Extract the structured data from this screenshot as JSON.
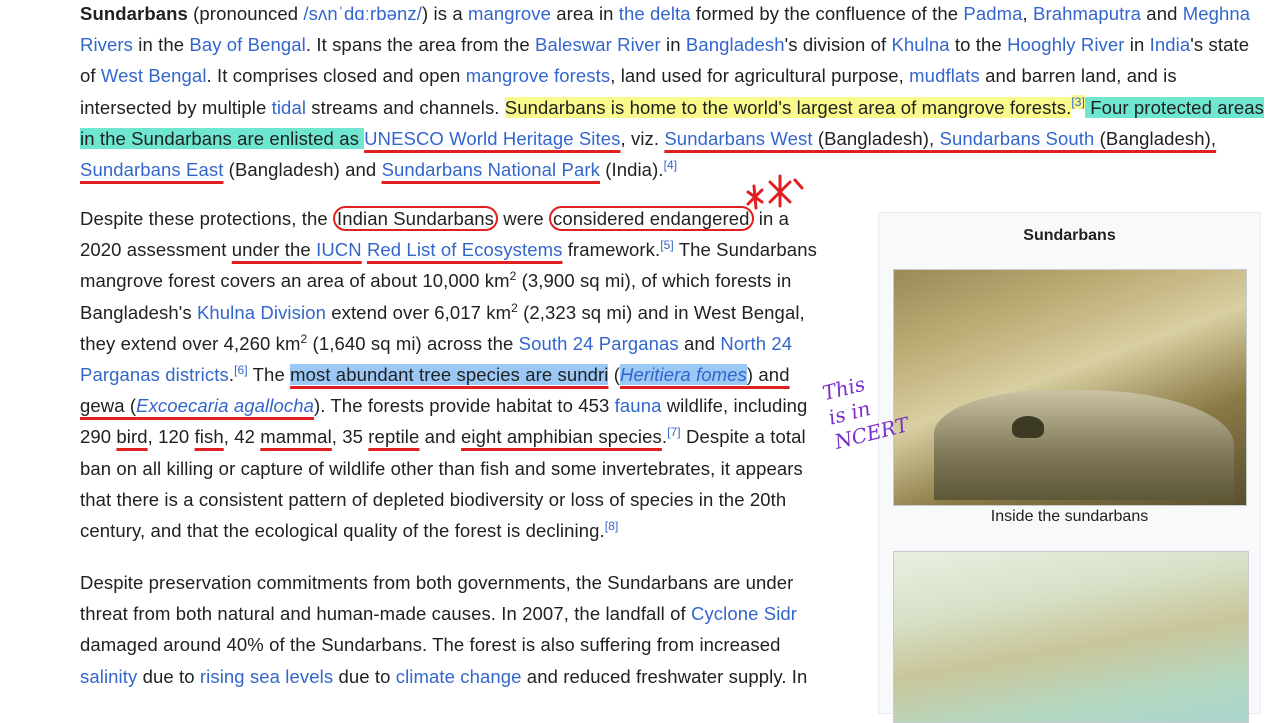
{
  "p1": {
    "s1": "Sundarbans",
    "s2": " (pronounced ",
    "ipa": "/sʌnˈdɑːrbənz/",
    "s3": ") is a ",
    "l_mangrove": "mangrove",
    "s4": " area in ",
    "l_delta": "the delta",
    "s5": " formed by the confluence of the ",
    "l_padma": "Padma",
    "s6": ", ",
    "l_brahma": "Brahmaputra",
    "s7": " and ",
    "l_meghna": "Meghna Rivers",
    "s8": " in the ",
    "l_bay": "Bay of Bengal",
    "s9": ". It spans the area from the ",
    "l_baleswar": "Baleswar River",
    "s10": " in ",
    "l_bangladesh": "Bangladesh",
    "s11": "'s division of ",
    "l_khulna": "Khulna",
    "s12": " to the ",
    "l_hooghly": "Hooghly River",
    "s13": " in ",
    "l_india": "India",
    "s14": "'s state of ",
    "l_wb": "West Bengal",
    "s15": ". It comprises closed and open ",
    "l_mforests": "mangrove forests",
    "s16": ", land used for agricultural purpose, ",
    "l_mudflats": "mudflats",
    "s17": " and barren land, and is intersected by multiple ",
    "l_tidal": "tidal",
    "s18": " streams and channels. ",
    "hl1": "Sundarbans is home to the world's largest area of mangrove forests.",
    "ref3": "[3]",
    "hl2": " Four protected areas in the Sundarbans are enlisted as ",
    "l_unesco": "UNESCO World Heritage Sites",
    "s19": ", viz. ",
    "l_west": "Sundarbans West",
    "s20": " (Bangladesh), ",
    "l_south": "Sundarbans South",
    "s21": " (Bangladesh), ",
    "l_east": "Sundarbans East",
    "s22": " (Bangladesh) and ",
    "l_np": "Sundarbans National Park",
    "s23": " (India).",
    "ref4": "[4]"
  },
  "p2": {
    "s1": "Despite these protections, the ",
    "c1": "Indian Sundarbans",
    "s2": " were ",
    "c2": "considered endangered",
    "s3": " in a 2020 assessment ",
    "u1": "under the ",
    "l_iucn": "IUCN",
    "s4": " ",
    "l_redlist": "Red List of Ecosystems",
    "s5": " framework.",
    "ref5": "[5]",
    "s6": " The Sundarbans mangrove forest covers an area of about 10,000 km",
    "sq": "2",
    "s7": " (3,900 sq mi), of which forests in Bangladesh's ",
    "l_kdiv": "Khulna Division",
    "s8": " extend over 6,017 km",
    "s9": " (2,323 sq mi) and in West Bengal, they extend over 4,260 km",
    "s10": " (1,640 sq mi) across the ",
    "l_s24": "South 24 Parganas",
    "s11": " and ",
    "l_n24": "North 24 Parganas districts",
    "s12": ".",
    "ref6": "[6]",
    "s13": " The ",
    "hl": "most abundant tree species are sundri",
    "s14": " (",
    "l_heritiera": "Heritiera fomes",
    "s15": ") and gewa (",
    "l_excoecaria": "Excoecaria agallocha",
    "s16": "). The forests provide habitat to 453 ",
    "l_fauna": "fauna",
    "s17": " wildlife, including 290 ",
    "u_bird": "bird",
    "s18": ", 120 ",
    "u_fish": "fish",
    "s19": ", 42 ",
    "u_mammal": "mammal",
    "s20": ", 35 ",
    "u_reptile": "reptile",
    "s21": " and ",
    "u_amph": "eight amphibian species",
    "s22": ".",
    "ref7": "[7]",
    "s23": " Despite a total ban on all killing or capture of wildlife other than fish and some invertebrates, it appears that there is a consistent pattern of depleted biodiversity or loss of species in the 20th century, and that the ecological quality of the forest is declining.",
    "ref8": "[8]"
  },
  "p3": {
    "s1": "Despite preservation commitments from both governments, the Sundarbans are under threat from both natural and human-made causes. In 2007, the landfall of ",
    "l_sidr": "Cyclone Sidr",
    "s2": " damaged around 40% of the Sundarbans. The forest is also suffering from increased ",
    "l_salinity": "salinity",
    "s3": " due to ",
    "l_sea": "rising sea levels",
    "s4": " due to ",
    "l_climate": "climate change",
    "s5": " and reduced freshwater supply. In"
  },
  "infobox": {
    "title": "Sundarbans",
    "caption": "Inside the sundarbans"
  },
  "note": {
    "line1": "This",
    "line2": "is in",
    "line3": "NCERT"
  },
  "colors": {
    "link": "#3366cc",
    "highlight_yellow": "#fafa8c",
    "highlight_green": "#6fe6cf",
    "highlight_blue": "#9bc8f5",
    "annotation_red": "#e02020",
    "annotation_purple": "#7a2fc8"
  }
}
